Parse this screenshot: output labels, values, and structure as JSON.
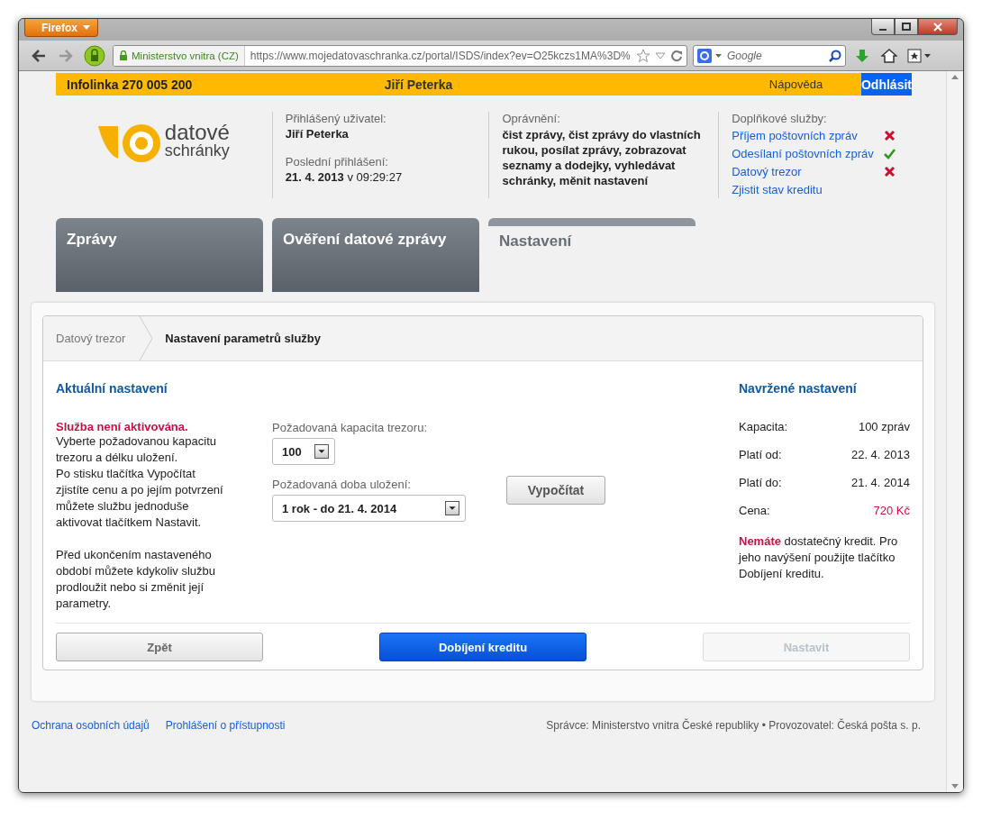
{
  "browser": {
    "menu_button": "Firefox",
    "identity": "Ministerstvo vnitra (CZ)",
    "url": "https://www.mojedatovaschranka.cz/portal/ISDS/index?ev=O25kczs1MA%3D%",
    "search_placeholder": "Google"
  },
  "topbar": {
    "hotline": "Infolinka 270 005 200",
    "user": "Jiří Peterka",
    "help": "Nápověda",
    "logout": "Odhlásit"
  },
  "logo": {
    "line1": "datové",
    "line2": "schránky"
  },
  "user_info": [
    {
      "label": "Přihlášený uživatel:",
      "value": "**Jiří Peterka**"
    },
    {
      "label": "Poslední přihlášení:",
      "value": "**21. 4. 2013** v 09:29:27"
    }
  ],
  "permissions": {
    "label": "Oprávnění:",
    "value": "čist zprávy, čist zprávy do vlastních rukou, posílat zprávy, zobrazovat seznamy a dodejky, vyhledávat schránky, měnit nastavení"
  },
  "services": {
    "label": "Doplňkové služby:",
    "items": [
      {
        "name": "Příjem poštovních zpráv",
        "kind": "status",
        "active": false
      },
      {
        "name": "Odesílaní poštovních zpráv",
        "kind": "status",
        "active": true
      },
      {
        "name": "Datový trezor",
        "kind": "status",
        "active": false
      },
      {
        "name": "Zjistit stav kreditu",
        "kind": "link"
      }
    ]
  },
  "tabs": [
    {
      "label": "Zprávy",
      "selected": false
    },
    {
      "label": "Ověření datové zprávy",
      "selected": false
    },
    {
      "label": "Nastavení",
      "selected": true
    }
  ],
  "breadcrumb": [
    "Datový trezor",
    "Nastavení parametrů služby"
  ],
  "current": {
    "title": "Aktuální nastavení",
    "warning": "Služba není aktivována.",
    "paragraphs": [
      "Vyberte požadovanou kapacitu trezoru a délku uložení.",
      "Po stisku tlačítka Vypočítat zjistíte cenu a po jejím potvrzení můžete službu jednoduše aktivovat tlačítkem Nastavit.",
      "Před ukončením nastaveného období můžete kdykoliv službu prodloužit nebo si změnit její parametry."
    ]
  },
  "form": {
    "fields": [
      {
        "label": "Požadovaná kapacita trezoru:",
        "value": "100"
      },
      {
        "label": "Požadovaná doba uložení:",
        "value": "1 rok - do 21. 4. 2014"
      }
    ],
    "calculate": "Vypočítat"
  },
  "proposed": {
    "title": "Navržené nastavení",
    "rows": [
      {
        "label": "Kapacita:",
        "value": "100 zpráv",
        "highlight": false
      },
      {
        "label": "Platí od:",
        "value": "22. 4. 2013",
        "highlight": false
      },
      {
        "label": "Platí do:",
        "value": "21. 4. 2014",
        "highlight": false
      },
      {
        "label": "Cena:",
        "value": "720 Kč",
        "highlight": true
      }
    ],
    "note": "**Nemáte** dostatečný kredit. Pro jeho navýšení použijte tlačítko Dobíjení kreditu."
  },
  "buttons": [
    {
      "label": "Zpět",
      "kind": "secondary",
      "disabled": false
    },
    {
      "label": "Dobíjení kreditu",
      "kind": "primary",
      "disabled": false
    },
    {
      "label": "Nastavit",
      "kind": "secondary",
      "disabled": true
    }
  ],
  "footer": {
    "links": [
      "Ochrana osobních údajů",
      "Prohlášení o přístupnosti"
    ],
    "text": "Správce: Ministerstvo vnitra České republiky • Provozovatel: Česká pošta s. p."
  }
}
